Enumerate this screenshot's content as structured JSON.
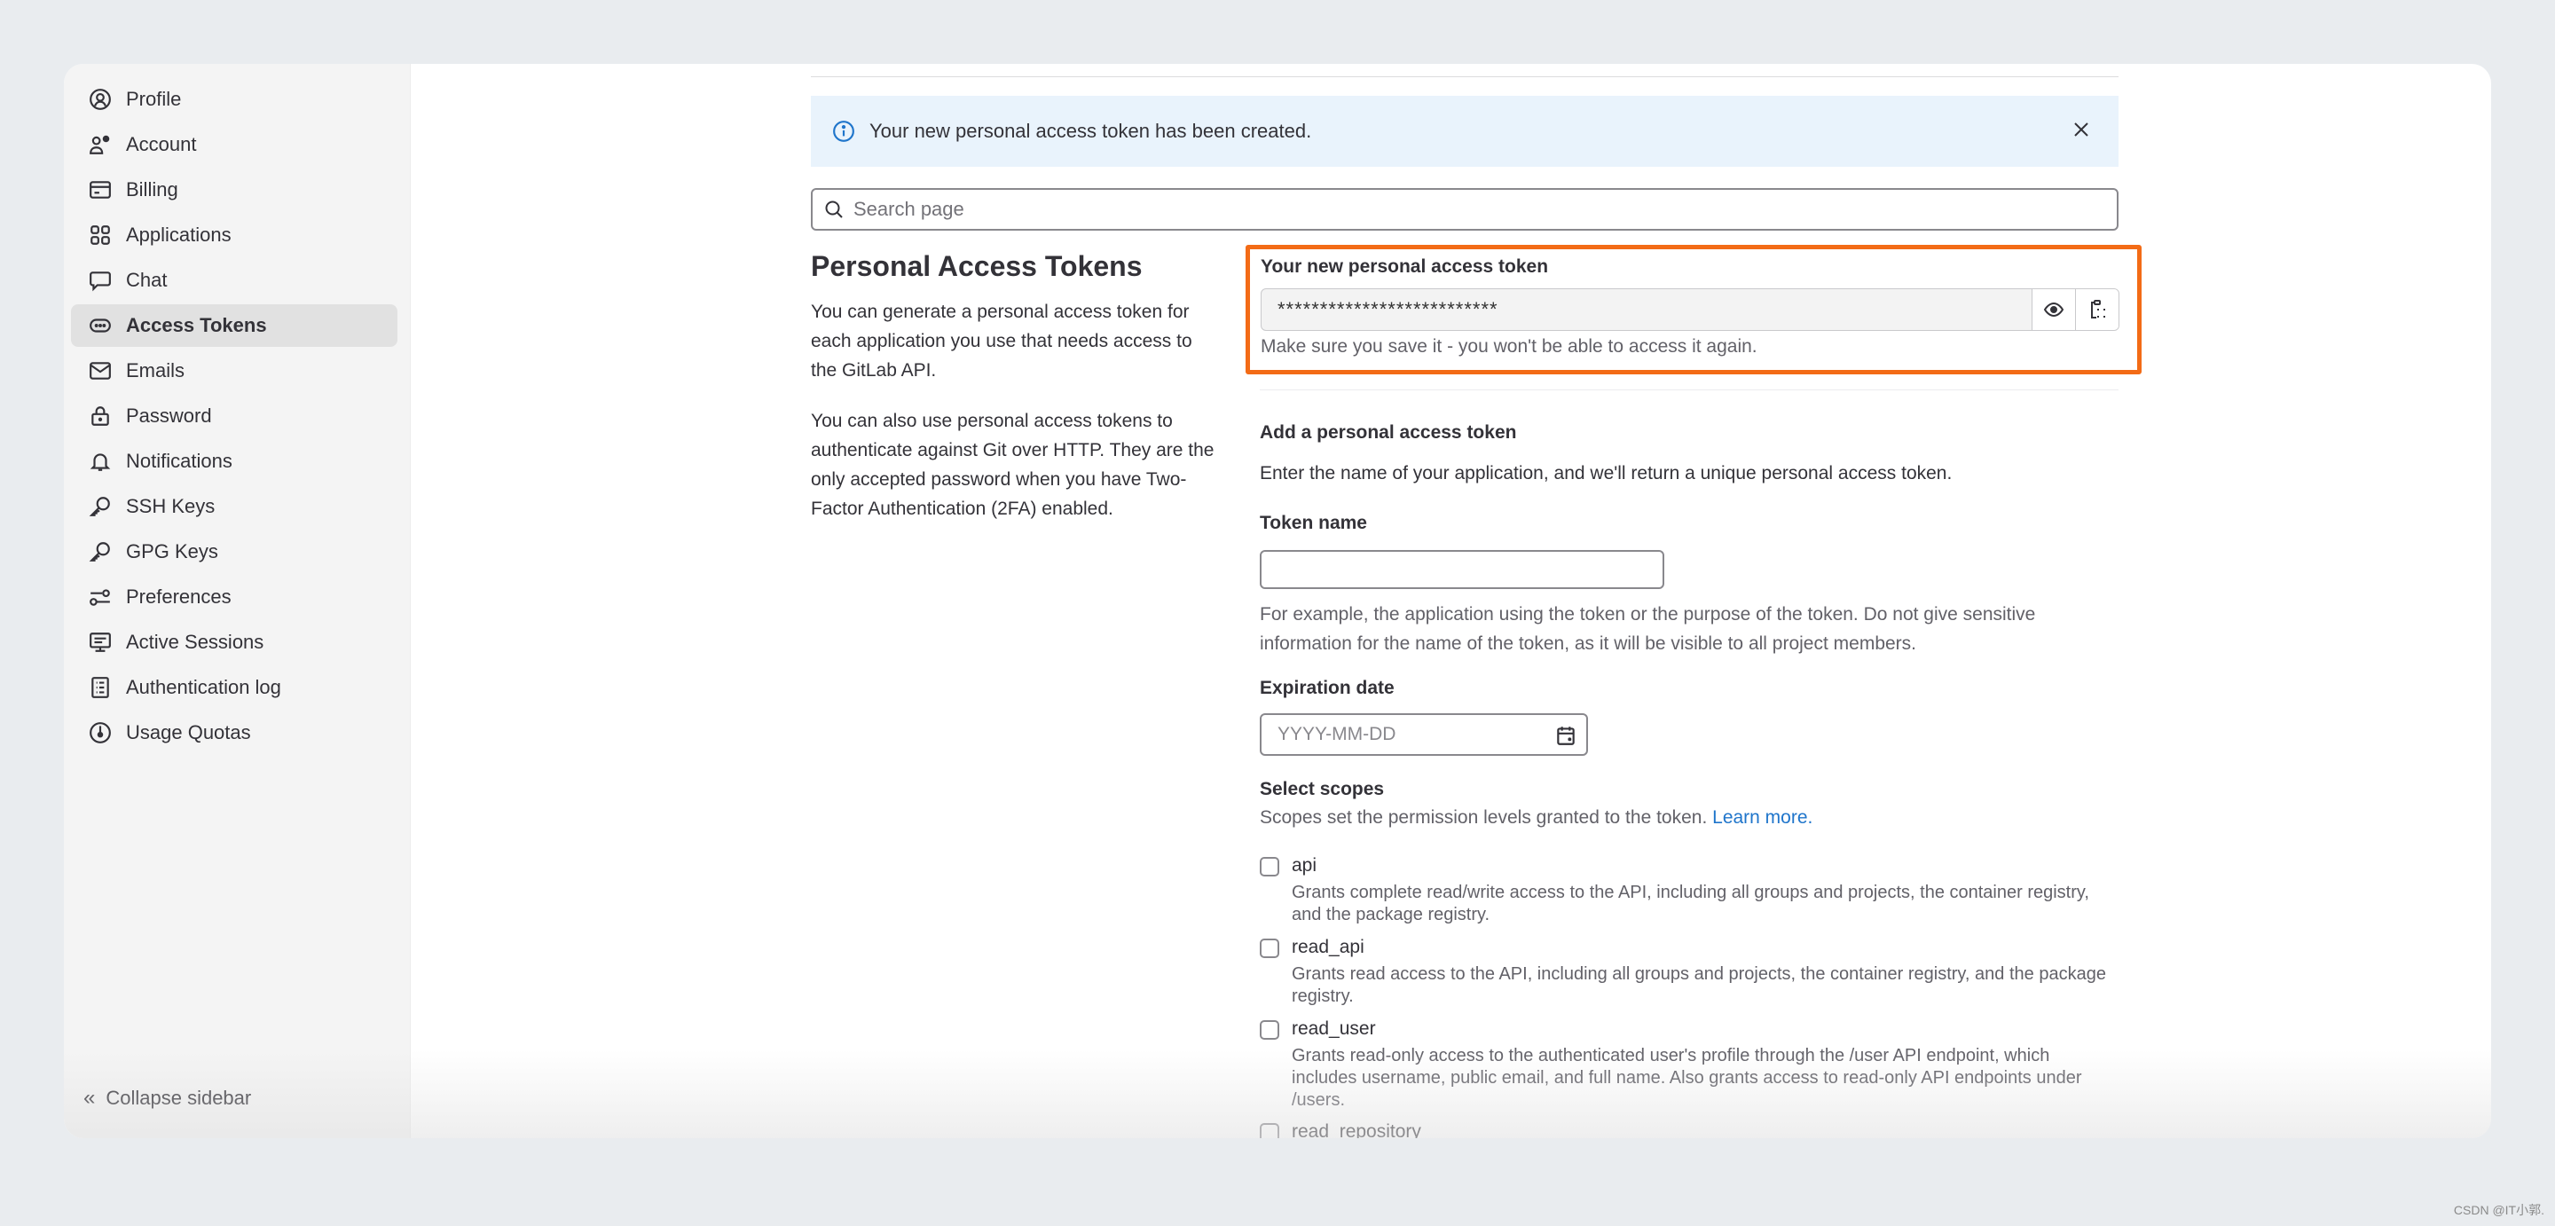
{
  "sidebar": {
    "items": [
      {
        "label": "Profile",
        "icon": "profile-icon"
      },
      {
        "label": "Account",
        "icon": "account-icon"
      },
      {
        "label": "Billing",
        "icon": "credit-card-icon"
      },
      {
        "label": "Applications",
        "icon": "applications-icon"
      },
      {
        "label": "Chat",
        "icon": "comment-icon"
      },
      {
        "label": "Access Tokens",
        "icon": "token-icon",
        "active": true
      },
      {
        "label": "Emails",
        "icon": "mail-icon"
      },
      {
        "label": "Password",
        "icon": "lock-icon"
      },
      {
        "label": "Notifications",
        "icon": "bell-icon"
      },
      {
        "label": "SSH Keys",
        "icon": "key-icon"
      },
      {
        "label": "GPG Keys",
        "icon": "key-icon"
      },
      {
        "label": "Preferences",
        "icon": "preferences-icon"
      },
      {
        "label": "Active Sessions",
        "icon": "monitor-icon"
      },
      {
        "label": "Authentication log",
        "icon": "log-icon"
      },
      {
        "label": "Usage Quotas",
        "icon": "quota-icon"
      }
    ],
    "collapse_label": "Collapse sidebar"
  },
  "alert": {
    "message": "Your new personal access token has been created."
  },
  "search": {
    "placeholder": "Search page"
  },
  "intro": {
    "title": "Personal Access Tokens",
    "p1": "You can generate a personal access token for each application you use that needs access to the GitLab API.",
    "p2": "You can also use personal access tokens to authenticate against Git over HTTP. They are the only accepted password when you have Two-Factor Authentication (2FA) enabled."
  },
  "new_token": {
    "title": "Your new personal access token",
    "masked_value": "**************************",
    "hint": "Make sure you save it - you won't be able to access it again.",
    "highlight_color": "#f36b16"
  },
  "form": {
    "heading": "Add a personal access token",
    "description": "Enter the name of your application, and we'll return a unique personal access token.",
    "token_name_label": "Token name",
    "token_name_value": "",
    "token_name_help": "For example, the application using the token or the purpose of the token. Do not give sensitive information for the name of the token, as it will be visible to all project members.",
    "expiration_label": "Expiration date",
    "expiration_placeholder": "YYYY-MM-DD",
    "scopes_label": "Select scopes",
    "scopes_description": "Scopes set the permission levels granted to the token.",
    "learn_more": "Learn more.",
    "scopes": [
      {
        "name": "api",
        "checked": false,
        "description": "Grants complete read/write access to the API, including all groups and projects, the container registry, and the package registry."
      },
      {
        "name": "read_api",
        "checked": false,
        "description": "Grants read access to the API, including all groups and projects, the container registry, and the package registry."
      },
      {
        "name": "read_user",
        "checked": false,
        "description": "Grants read-only access to the authenticated user's profile through the /user API endpoint, which includes username, public email, and full name. Also grants access to read-only API endpoints under /users."
      },
      {
        "name": "read_repository",
        "checked": false,
        "description": ""
      }
    ]
  },
  "watermark": "CSDN @IT小郭."
}
